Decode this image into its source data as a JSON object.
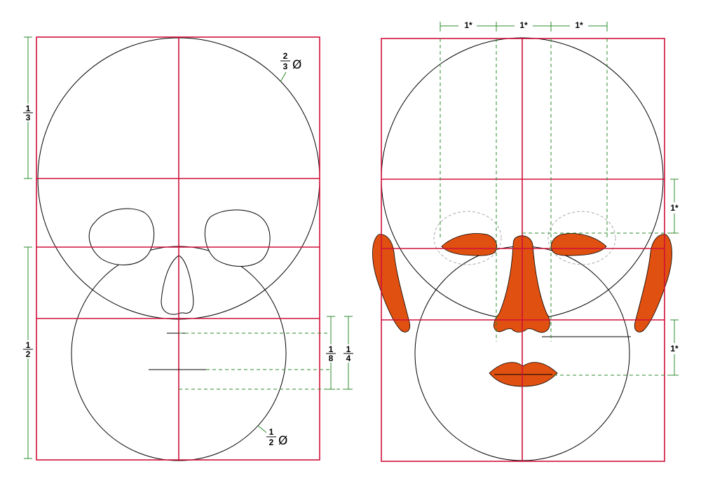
{
  "colors": {
    "frame": "#d0103a",
    "outline": "#000000",
    "guide": "#2e8b2e",
    "feature": "#e05010",
    "eye_guide": "#aaaaaa"
  },
  "left_panel": {
    "upper_circle_label": {
      "num": "2",
      "den": "3",
      "symbol": "Ø"
    },
    "lower_circle_label": {
      "num": "1",
      "den": "2",
      "symbol": "Ø"
    },
    "top_dimension": {
      "num": "1",
      "den": "3"
    },
    "bottom_dimension": {
      "num": "1",
      "den": "2"
    },
    "mouth_dimension_small": {
      "num": "1",
      "den": "8"
    },
    "mouth_dimension_large": {
      "num": "1",
      "den": "4"
    }
  },
  "right_panel": {
    "top_dimensions": [
      "1*",
      "1*",
      "1*"
    ],
    "ear_dimension_upper": "1*",
    "ear_dimension_lower": "1*"
  }
}
